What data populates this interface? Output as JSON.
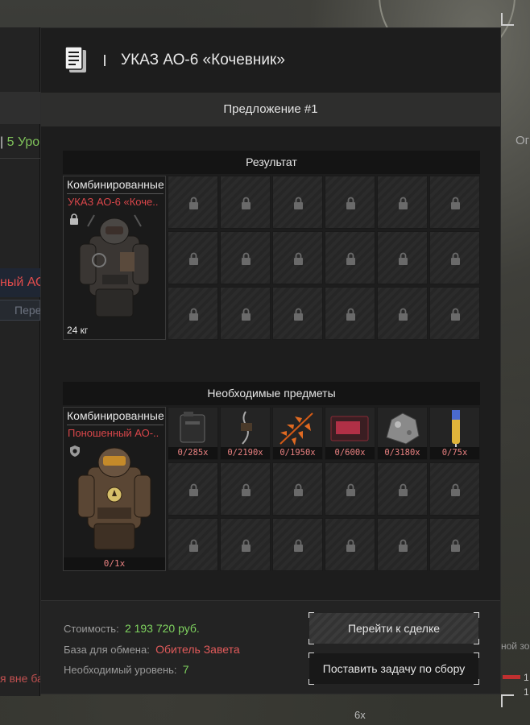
{
  "background": {
    "level_prefix": "5 Уро",
    "level_sep": "|",
    "red_item": "ный АО",
    "button_text": "Пере",
    "outside_text": "я вне ба",
    "right_label": "Ог",
    "right_note": "ной зо",
    "right_num1": "1",
    "right_num2": "1",
    "bottom_text": "6x"
  },
  "modal": {
    "title": "УКАЗ АО-6 «Кочевник»",
    "offer_label": "Предложение #1",
    "result": {
      "header": "Результат",
      "item": {
        "category": "Комбинированные",
        "name": "УКАЗ АО-6 «Коче..",
        "weight": "24 кг"
      },
      "grid_locked_count": 18
    },
    "required": {
      "header": "Необходимые предметы",
      "item": {
        "category": "Комбинированные",
        "name": "Поношенный АО-..",
        "count": "0/1x"
      },
      "materials": [
        {
          "count": "0/285x",
          "icon": "battery-icon"
        },
        {
          "count": "0/2190x",
          "icon": "wire-icon"
        },
        {
          "count": "0/1950x",
          "icon": "fern-icon"
        },
        {
          "count": "0/600x",
          "icon": "red-box-icon"
        },
        {
          "count": "0/3180x",
          "icon": "ore-icon"
        },
        {
          "count": "0/75x",
          "icon": "syringe-icon"
        }
      ]
    },
    "footer": {
      "cost_label": "Стоимость:",
      "cost_value": "2 193 720 руб.",
      "base_label": "База для обмена:",
      "base_value": "Обитель Завета",
      "level_label": "Необходимый уровень:",
      "level_value": "7",
      "deal_button": "Перейти к сделке",
      "task_button": "Поставить задачу по сбору"
    },
    "colors": {
      "accent_red": "#d9464a",
      "accent_green": "#7fd35f",
      "panel": "#1d1d1d"
    }
  }
}
